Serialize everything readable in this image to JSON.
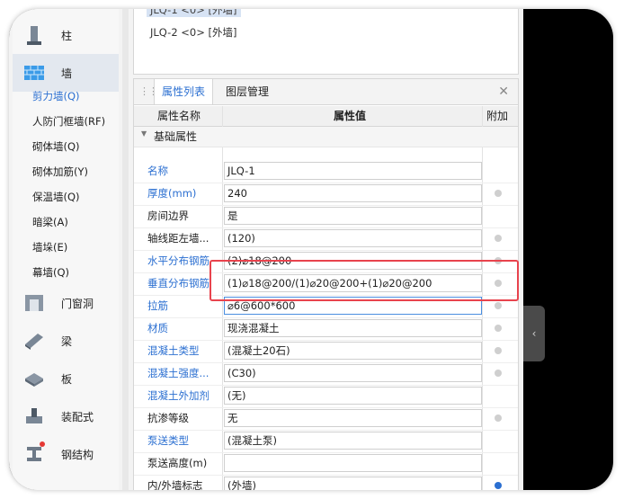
{
  "nav": {
    "categories": [
      {
        "label": "柱",
        "icon": "column-icon"
      },
      {
        "label": "墙",
        "icon": "wall-icon"
      },
      {
        "label": "门窗洞",
        "icon": "door-window-opening-icon"
      },
      {
        "label": "梁",
        "icon": "beam-icon"
      },
      {
        "label": "板",
        "icon": "slab-icon"
      },
      {
        "label": "装配式",
        "icon": "prefab-icon"
      },
      {
        "label": "钢结构",
        "icon": "steel-structure-icon"
      }
    ],
    "wall_items": [
      "剪力墙(Q)",
      "人防门框墙(RF)",
      "砌体墙(Q)",
      "砌体加筋(Y)",
      "保温墙(Q)",
      "暗梁(A)",
      "墙垛(E)",
      "幕墙(Q)"
    ],
    "active_item": "剪力墙(Q)"
  },
  "list": {
    "items": [
      "JLQ-1 <0> [外墙]",
      "JLQ-2 <0> [外墙]"
    ]
  },
  "panel": {
    "tabs": [
      "属性列表",
      "图层管理"
    ],
    "columns": [
      "属性名称",
      "属性值",
      "附加"
    ],
    "group_label": "基础属性",
    "rows": [
      {
        "name": "名称",
        "value": "JLQ-1",
        "link": true,
        "add": "none"
      },
      {
        "name": "厚度(mm)",
        "value": "240",
        "link": true,
        "add": "off"
      },
      {
        "name": "房间边界",
        "value": "是",
        "link": false,
        "add": "none"
      },
      {
        "name": "轴线距左墙...",
        "value": "(120)",
        "link": false,
        "add": "off"
      },
      {
        "name": "水平分布钢筋",
        "value": "(2)⌀18@200",
        "link": true,
        "add": "off"
      },
      {
        "name": "垂直分布钢筋",
        "value": "(1)⌀18@200/(1)⌀20@200+(1)⌀20@200",
        "link": true,
        "add": "off"
      },
      {
        "name": "拉筋",
        "value": "⌀6@600*600",
        "link": true,
        "add": "off"
      },
      {
        "name": "材质",
        "value": "现浇混凝土",
        "link": true,
        "add": "off"
      },
      {
        "name": "混凝土类型",
        "value": "(混凝土20石)",
        "link": true,
        "add": "off"
      },
      {
        "name": "混凝土强度...",
        "value": "(C30)",
        "link": true,
        "add": "off"
      },
      {
        "name": "混凝土外加剂",
        "value": "(无)",
        "link": true,
        "add": "none"
      },
      {
        "name": "抗渗等级",
        "value": "无",
        "link": false,
        "add": "off"
      },
      {
        "name": "泵送类型",
        "value": "(混凝土泵)",
        "link": true,
        "add": "none"
      },
      {
        "name": "泵送高度(m)",
        "value": "",
        "link": false,
        "add": "none"
      },
      {
        "name": "内/外墙标志",
        "value": "(外墙)",
        "link": false,
        "add": "on"
      }
    ]
  },
  "colors": {
    "accent": "#2b6fd1",
    "highlight": "#e8434d"
  }
}
